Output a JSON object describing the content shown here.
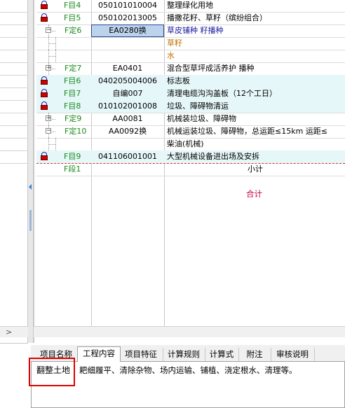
{
  "rows": [
    {
      "tag": "F目4",
      "code": "050101010004",
      "name": "整理绿化用地",
      "lock": true,
      "expander": "",
      "indent": 0
    },
    {
      "tag": "F目5",
      "code": "050102013005",
      "name": "播撒花籽、草籽（缤纷组合）",
      "lock": true,
      "expander": "",
      "indent": 0
    },
    {
      "tag": "F定6",
      "code": "EA0280换",
      "name": "草皮铺种 籽播种",
      "lock": false,
      "expander": "−",
      "indent": 1
    },
    {
      "tag": "",
      "code": "",
      "name": "草籽",
      "lock": false,
      "expander": "",
      "indent": 2
    },
    {
      "tag": "",
      "code": "",
      "name": "水",
      "lock": false,
      "expander": "",
      "indent": 2
    },
    {
      "tag": "F定7",
      "code": "EA0401",
      "name": "混合型草坪成活养护 播种",
      "lock": false,
      "expander": "+",
      "indent": 1
    },
    {
      "tag": "F目6",
      "code": "040205004006",
      "name": "标志板",
      "lock": true,
      "expander": "",
      "indent": 0
    },
    {
      "tag": "F目7",
      "code": "自编007",
      "name": "清理电缆沟沟盖板（12个工日）",
      "lock": true,
      "expander": "",
      "indent": 0
    },
    {
      "tag": "F目8",
      "code": "010102001008",
      "name": "垃圾、障碍物清运",
      "lock": true,
      "expander": "",
      "indent": 0
    },
    {
      "tag": "F定9",
      "code": "AA0081",
      "name": "机械装垃圾、障碍物",
      "lock": false,
      "expander": "+",
      "indent": 1
    },
    {
      "tag": "F定10",
      "code": "AA0092换",
      "name": "机械运装垃圾、障碍物，总运距≤15km 运距≤",
      "lock": false,
      "expander": "−",
      "indent": 1
    },
    {
      "tag": "",
      "code": "",
      "name": "柴油(机械)",
      "lock": false,
      "expander": "",
      "indent": 2
    },
    {
      "tag": "F目9",
      "code": "041106001001",
      "name": "大型机械设备进出场及安拆",
      "lock": true,
      "expander": "",
      "indent": 0
    },
    {
      "tag": "F段1",
      "code": "",
      "name": "小计",
      "lock": false,
      "expander": "",
      "indent": 0
    }
  ],
  "total_label": "合计",
  "tabs": [
    "项目名称",
    "工程内容",
    "项目特征",
    "计算规则",
    "计算式",
    "附注",
    "审核说明"
  ],
  "active_tab": 1,
  "content": {
    "title": "翻整土地",
    "text": "耙细履平、清除杂物、场内运输、铺植、浇定根水、清理等。"
  },
  "scroll_left_arrow": "<",
  "scroll_right_arrow": ">",
  "colors": {
    "tag_green": "#1a8a1a",
    "blue_text": "#1a1aa0",
    "orange_text": "#c07000",
    "red_text": "#cc0044",
    "highlight": "#e6f7f9",
    "selected_cell": "#bcd3ee",
    "focus_box": "#e00000"
  }
}
